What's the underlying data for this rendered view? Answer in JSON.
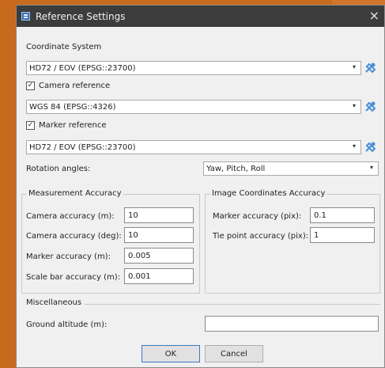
{
  "dialog": {
    "title": "Reference Settings",
    "close_glyph": "×",
    "icon": "reference-settings-icon"
  },
  "coordinate_system": {
    "label": "Coordinate System",
    "value": "HD72 / EOV (EPSG::23700)"
  },
  "camera_reference": {
    "label": "Camera reference",
    "checked": true,
    "value": "WGS 84 (EPSG::4326)"
  },
  "marker_reference": {
    "label": "Marker reference",
    "checked": true,
    "value": "HD72 / EOV (EPSG::23700)"
  },
  "rotation_angles": {
    "label": "Rotation angles:",
    "value": "Yaw, Pitch, Roll"
  },
  "measurement_accuracy": {
    "title": "Measurement Accuracy",
    "camera_m_label": "Camera accuracy (m):",
    "camera_m_value": "10",
    "camera_deg_label": "Camera accuracy (deg):",
    "camera_deg_value": "10",
    "marker_m_label": "Marker accuracy (m):",
    "marker_m_value": "0.005",
    "scalebar_m_label": "Scale bar accuracy (m):",
    "scalebar_m_value": "0.001"
  },
  "image_accuracy": {
    "title": "Image Coordinates Accuracy",
    "marker_pix_label": "Marker accuracy (pix):",
    "marker_pix_value": "0.1",
    "tiepoint_pix_label": "Tie point accuracy (pix):",
    "tiepoint_pix_value": "1"
  },
  "misc": {
    "title": "Miscellaneous",
    "ground_altitude_label": "Ground altitude (m):",
    "ground_altitude_value": ""
  },
  "buttons": {
    "ok": "OK",
    "cancel": "Cancel"
  },
  "icons": {
    "combo_arrow": "▾",
    "check": "✓"
  },
  "colors": {
    "titlebar": "#3c3c3c",
    "background": "#c86a1e",
    "dialog_bg": "#f0f0f0",
    "tool_icon": "#4a90d9"
  }
}
